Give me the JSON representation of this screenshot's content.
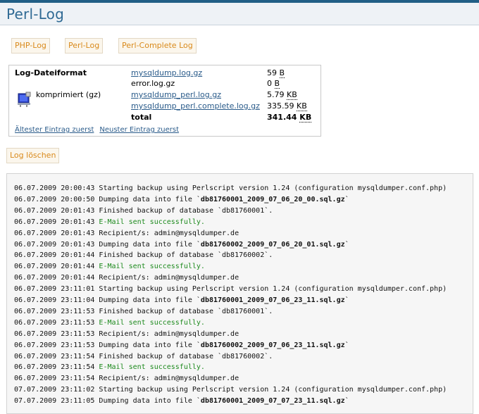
{
  "page": {
    "title": "Perl-Log"
  },
  "tabs": [
    "PHP-Log",
    "Perl-Log",
    "Perl-Complete Log"
  ],
  "info": {
    "label": "Log-Dateiformat",
    "compression": "komprimiert (gz)",
    "files": [
      {
        "name": "mysqldump.log.gz",
        "size_num": "59",
        "size_unit": "B",
        "link": true
      },
      {
        "name": "error.log.gz",
        "size_num": "0",
        "size_unit": "B",
        "link": false
      },
      {
        "name": "mysqldump_perl.log.gz",
        "size_num": "5.79",
        "size_unit": "KB",
        "link": true
      },
      {
        "name": "mysqldump_perl.complete.log.gz",
        "size_num": "335.59",
        "size_unit": "KB",
        "link": true
      }
    ],
    "total_label": "total",
    "total_num": "341.44",
    "total_unit": "KB",
    "oldest_first": "Ältester Eintrag zuerst",
    "newest_first": "Neuster Eintrag zuerst"
  },
  "delete_button": "Log löschen",
  "log": [
    {
      "ts": "06.07.2009 20:00:43",
      "pre": "Starting backup using Perlscript version 1.24 (configuration mysqldumper.conf.php)",
      "file": "",
      "post": "",
      "ok": false
    },
    {
      "ts": "06.07.2009 20:00:50",
      "pre": "Dumping data into file `",
      "file": "db81760001_2009_07_06_20_00.sql.gz",
      "post": "`",
      "ok": false
    },
    {
      "ts": "06.07.2009 20:01:43",
      "pre": "Finished backup of database `db81760001`.",
      "file": "",
      "post": "",
      "ok": false
    },
    {
      "ts": "06.07.2009 20:01:43",
      "pre": "E-Mail sent successfully.",
      "file": "",
      "post": "",
      "ok": true
    },
    {
      "ts": "06.07.2009 20:01:43",
      "pre": "Recipient/s: admin@mysqldumper.de",
      "file": "",
      "post": "",
      "ok": false
    },
    {
      "ts": "06.07.2009 20:01:43",
      "pre": "Dumping data into file `",
      "file": "db81760002_2009_07_06_20_01.sql.gz",
      "post": "`",
      "ok": false
    },
    {
      "ts": "06.07.2009 20:01:44",
      "pre": "Finished backup of database `db81760002`.",
      "file": "",
      "post": "",
      "ok": false
    },
    {
      "ts": "06.07.2009 20:01:44",
      "pre": "E-Mail sent successfully.",
      "file": "",
      "post": "",
      "ok": true
    },
    {
      "ts": "06.07.2009 20:01:44",
      "pre": "Recipient/s: admin@mysqldumper.de",
      "file": "",
      "post": "",
      "ok": false
    },
    {
      "ts": "06.07.2009 23:11:01",
      "pre": "Starting backup using Perlscript version 1.24 (configuration mysqldumper.conf.php)",
      "file": "",
      "post": "",
      "ok": false
    },
    {
      "ts": "06.07.2009 23:11:04",
      "pre": "Dumping data into file `",
      "file": "db81760001_2009_07_06_23_11.sql.gz",
      "post": "`",
      "ok": false
    },
    {
      "ts": "06.07.2009 23:11:53",
      "pre": "Finished backup of database `db81760001`.",
      "file": "",
      "post": "",
      "ok": false
    },
    {
      "ts": "06.07.2009 23:11:53",
      "pre": "E-Mail sent successfully.",
      "file": "",
      "post": "",
      "ok": true
    },
    {
      "ts": "06.07.2009 23:11:53",
      "pre": "Recipient/s: admin@mysqldumper.de",
      "file": "",
      "post": "",
      "ok": false
    },
    {
      "ts": "06.07.2009 23:11:53",
      "pre": "Dumping data into file `",
      "file": "db81760002_2009_07_06_23_11.sql.gz",
      "post": "`",
      "ok": false
    },
    {
      "ts": "06.07.2009 23:11:54",
      "pre": "Finished backup of database `db81760002`.",
      "file": "",
      "post": "",
      "ok": false
    },
    {
      "ts": "06.07.2009 23:11:54",
      "pre": "E-Mail sent successfully.",
      "file": "",
      "post": "",
      "ok": true
    },
    {
      "ts": "06.07.2009 23:11:54",
      "pre": "Recipient/s: admin@mysqldumper.de",
      "file": "",
      "post": "",
      "ok": false
    },
    {
      "ts": "07.07.2009 23:11:02",
      "pre": "Starting backup using Perlscript version 1.24 (configuration mysqldumper.conf.php)",
      "file": "",
      "post": "",
      "ok": false
    },
    {
      "ts": "07.07.2009 23:11:05",
      "pre": "Dumping data into file `",
      "file": "db81760001_2009_07_07_23_11.sql.gz",
      "post": "`",
      "ok": false
    }
  ]
}
